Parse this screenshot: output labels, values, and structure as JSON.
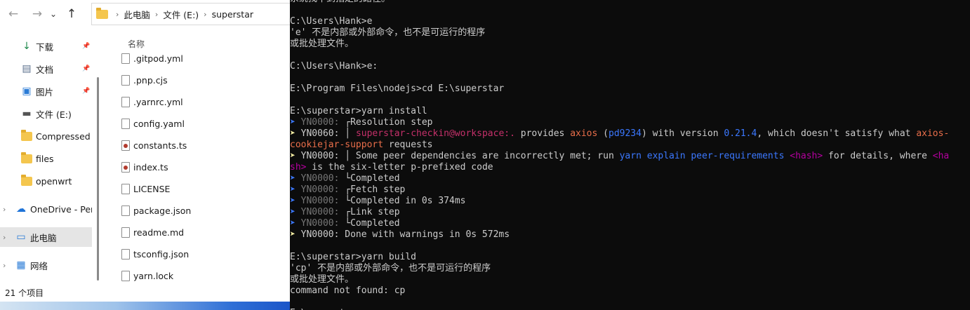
{
  "explorer": {
    "breadcrumb": [
      "此电脑",
      "文件 (E:)",
      "superstar"
    ],
    "nav": {
      "back": "←",
      "forward": "→",
      "dropdown": "⌄",
      "up": "↑"
    },
    "column_header": "名称",
    "sidebar": [
      {
        "label": "下载",
        "icon": "download-icon",
        "pinned": true
      },
      {
        "label": "文档",
        "icon": "document-icon",
        "pinned": true
      },
      {
        "label": "图片",
        "icon": "picture-icon",
        "pinned": true
      },
      {
        "label": "文件 (E:)",
        "icon": "drive-icon",
        "pinned": false
      },
      {
        "label": "Compressed",
        "icon": "folder-icon",
        "pinned": false
      },
      {
        "label": "files",
        "icon": "folder-icon",
        "pinned": false
      },
      {
        "label": "openwrt",
        "icon": "folder-icon",
        "pinned": false
      },
      {
        "label": "OneDrive - Pers",
        "icon": "cloud-icon",
        "pinned": false
      },
      {
        "label": "此电脑",
        "icon": "computer-icon",
        "pinned": false,
        "selected": true
      },
      {
        "label": "网络",
        "icon": "network-icon",
        "pinned": false
      }
    ],
    "files": [
      {
        "name": ".gitpod.yml",
        "type": "file"
      },
      {
        "name": ".pnp.cjs",
        "type": "file"
      },
      {
        "name": ".yarnrc.yml",
        "type": "file"
      },
      {
        "name": "config.yaml",
        "type": "file"
      },
      {
        "name": "constants.ts",
        "type": "ts"
      },
      {
        "name": "index.ts",
        "type": "ts"
      },
      {
        "name": "LICENSE",
        "type": "file"
      },
      {
        "name": "package.json",
        "type": "file"
      },
      {
        "name": "readme.md",
        "type": "file"
      },
      {
        "name": "tsconfig.json",
        "type": "file"
      },
      {
        "name": "yarn.lock",
        "type": "file"
      }
    ],
    "status": "21 个项目"
  },
  "console": {
    "colors": {
      "text": "#cccccc",
      "background": "#0c0c0c",
      "arrow_yellow": "#f9f1a5",
      "arrow_blue": "#3b78ff",
      "package_pink": "#c5306a",
      "hash_purple": "#b4009e",
      "link_blue": "#3b78ff"
    },
    "lines": [
      [
        {
          "t": "系统找不到指定的路径。"
        }
      ],
      [
        {
          "t": ""
        }
      ],
      [
        {
          "t": "C:\\Users\\Hank>e"
        }
      ],
      [
        {
          "t": "'e' 不是内部或外部命令，也不是可运行的程序"
        }
      ],
      [
        {
          "t": "或批处理文件。"
        }
      ],
      [
        {
          "t": ""
        }
      ],
      [
        {
          "t": "C:\\Users\\Hank>e:"
        }
      ],
      [
        {
          "t": ""
        }
      ],
      [
        {
          "t": "E:\\Program Files\\nodejs>cd E:\\superstar"
        }
      ],
      [
        {
          "t": ""
        }
      ],
      [
        {
          "t": "E:\\superstar>yarn install"
        }
      ],
      [
        {
          "t": "➤ ",
          "c": "b"
        },
        {
          "t": "YN0000: ",
          "c": "g"
        },
        {
          "t": "┌Resolution step"
        }
      ],
      [
        {
          "t": "➤ ",
          "c": "y"
        },
        {
          "t": "YN0060: │ "
        },
        {
          "t": "superstar-checkin",
          "c": "m"
        },
        {
          "t": "@workspace:.",
          "c": "m"
        },
        {
          "t": " provides "
        },
        {
          "t": "axios",
          "c": "o"
        },
        {
          "t": " ("
        },
        {
          "t": "pd9234",
          "c": "b"
        },
        {
          "t": ") with version "
        },
        {
          "t": "0.21.4",
          "c": "b"
        },
        {
          "t": ", which doesn't satisfy what "
        },
        {
          "t": "axios-",
          "c": "o"
        }
      ],
      [
        {
          "t": "cookiejar-support",
          "c": "o"
        },
        {
          "t": " requests"
        }
      ],
      [
        {
          "t": "➤ ",
          "c": "y"
        },
        {
          "t": "YN0000: │ Some peer dependencies are incorrectly met; run "
        },
        {
          "t": "yarn explain peer-requirements ",
          "c": "b"
        },
        {
          "t": "<hash>",
          "c": "m2"
        },
        {
          "t": " for details, where "
        },
        {
          "t": "<ha",
          "c": "m2"
        }
      ],
      [
        {
          "t": "sh>",
          "c": "m2"
        },
        {
          "t": " is the six-letter p-prefixed code"
        }
      ],
      [
        {
          "t": "➤ ",
          "c": "b"
        },
        {
          "t": "YN0000: ",
          "c": "g"
        },
        {
          "t": "└Completed"
        }
      ],
      [
        {
          "t": "➤ ",
          "c": "b"
        },
        {
          "t": "YN0000: ",
          "c": "g"
        },
        {
          "t": "┌Fetch step"
        }
      ],
      [
        {
          "t": "➤ ",
          "c": "b"
        },
        {
          "t": "YN0000: ",
          "c": "g"
        },
        {
          "t": "└Completed in 0s 374ms"
        }
      ],
      [
        {
          "t": "➤ ",
          "c": "b"
        },
        {
          "t": "YN0000: ",
          "c": "g"
        },
        {
          "t": "┌Link step"
        }
      ],
      [
        {
          "t": "➤ ",
          "c": "b"
        },
        {
          "t": "YN0000: ",
          "c": "g"
        },
        {
          "t": "└Completed"
        }
      ],
      [
        {
          "t": "➤ ",
          "c": "y"
        },
        {
          "t": "YN0000: Done with warnings in 0s 572ms"
        }
      ],
      [
        {
          "t": ""
        }
      ],
      [
        {
          "t": "E:\\superstar>yarn build"
        }
      ],
      [
        {
          "t": "'cp' 不是内部或外部命令，也不是可运行的程序"
        }
      ],
      [
        {
          "t": "或批处理文件。"
        }
      ],
      [
        {
          "t": "command not found: cp"
        }
      ],
      [
        {
          "t": ""
        }
      ],
      [
        {
          "t": "E:\\superstar>"
        }
      ]
    ]
  }
}
